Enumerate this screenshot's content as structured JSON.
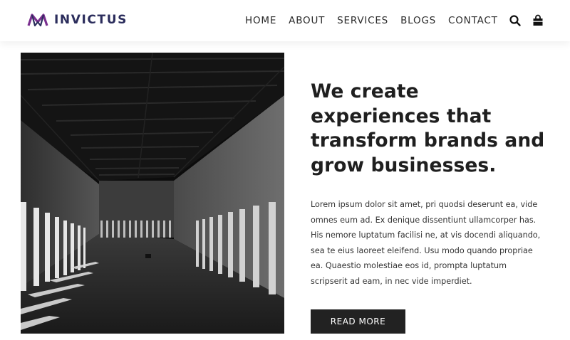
{
  "brand": {
    "name": "INVICTUS",
    "logo_icon": "crown-m-logo-icon",
    "colors": {
      "logo_primary": "#7a2f8f",
      "logo_secondary": "#2b2d5c"
    }
  },
  "nav": {
    "items": [
      {
        "label": "HOME"
      },
      {
        "label": "ABOUT"
      },
      {
        "label": "SERVICES"
      },
      {
        "label": "BLOGS"
      },
      {
        "label": "CONTACT"
      }
    ],
    "search_icon": "search-icon",
    "cart_icon": "shopping-bag-icon"
  },
  "hero": {
    "image_icon": "corridor-photo",
    "headline": "We create experiences that transform brands and grow businesses.",
    "body": "Lorem ipsum dolor sit amet, pri quodsi deserunt ea, vide omnes eum ad. Ex denique dissentiunt ullamcorper has. His nemore luptatum facilisi ne, at vis docendi aliquando, sea te eius laoreet eleifend. Usu modo quando propriae ea. Quaestio molestiae eos id, prompta luptatum scripserit ad eam, in nec vide imperdiet.",
    "cta_label": "READ MORE"
  }
}
